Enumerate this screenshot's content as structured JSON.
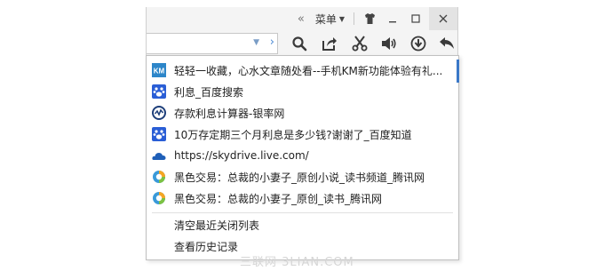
{
  "titlebar": {
    "menu_label": "菜单",
    "collapse_icon": "double-chevron-left-icon",
    "caret_icon": "caret-down-icon",
    "skin_icon": "shirt-icon",
    "minimize_icon": "minimize-icon",
    "maximize_icon": "maximize-icon",
    "close_icon": "close-icon"
  },
  "toolbar": {
    "address_value": "",
    "tools": [
      "search-icon",
      "share-icon",
      "scissors-icon",
      "speaker-icon",
      "download-icon",
      "back-arrow-icon"
    ]
  },
  "recent_closed": {
    "items": [
      {
        "icon": "km-icon",
        "title": "轻轻一收藏，心水文章随处看--手机KM新功能体验有礼..."
      },
      {
        "icon": "baidu-paw-icon",
        "title": "利息_百度搜索"
      },
      {
        "icon": "yinlv-icon",
        "title": "存款利息计算器-银率网"
      },
      {
        "icon": "baidu-paw-icon",
        "title": "10万存定期三个月利息是多少钱?谢谢了_百度知道"
      },
      {
        "icon": "onedrive-cloud-icon",
        "title": "https://skydrive.live.com/"
      },
      {
        "icon": "qq-news-icon",
        "title": "黑色交易：总裁的小妻子_原创小说_读书频道_腾讯网"
      },
      {
        "icon": "qq-news-icon",
        "title": "黑色交易：总裁的小妻子_原创_读书_腾讯网"
      }
    ],
    "clear_label": "清空最近关闭列表",
    "history_label": "查看历史记录"
  },
  "watermark": "三联网 3LIAN.COM",
  "colors": {
    "accent": "#3a78c8",
    "toolbar_icon": "#3a3a3a",
    "close_bg": "#e3e3e3"
  }
}
